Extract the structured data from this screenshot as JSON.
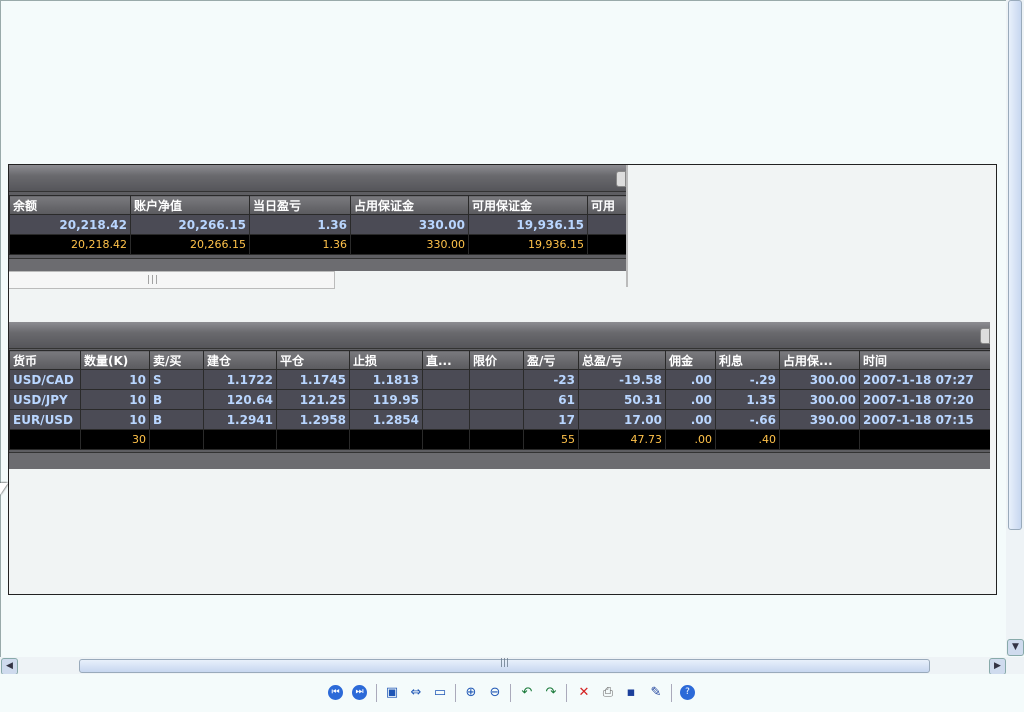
{
  "account_table": {
    "headers": [
      "余额",
      "账户净值",
      "当日盈亏",
      "占用保证金",
      "可用保证金",
      "可用"
    ],
    "row": [
      "20,218.42",
      "20,266.15",
      "1.36",
      "330.00",
      "19,936.15",
      ""
    ],
    "total": [
      "20,218.42",
      "20,266.15",
      "1.36",
      "330.00",
      "19,936.15",
      ""
    ]
  },
  "positions_table": {
    "headers": [
      "货币",
      "数量(K)",
      "卖/买",
      "建仓",
      "平仓",
      "止损",
      "直...",
      "限价",
      "盈/亏",
      "总盈/亏",
      "佣金",
      "利息",
      "占用保...",
      "时间"
    ],
    "rows": [
      [
        "USD/CAD",
        "10",
        "S",
        "1.1722",
        "1.1745",
        "1.1813",
        "",
        "",
        "-23",
        "-19.58",
        ".00",
        "-.29",
        "300.00",
        "2007-1-18 07:27"
      ],
      [
        "USD/JPY",
        "10",
        "B",
        "120.64",
        "121.25",
        "119.95",
        "",
        "",
        "61",
        "50.31",
        ".00",
        "1.35",
        "300.00",
        "2007-1-18 07:20"
      ],
      [
        "EUR/USD",
        "10",
        "B",
        "1.2941",
        "1.2958",
        "1.2854",
        "",
        "",
        "17",
        "17.00",
        ".00",
        "-.66",
        "390.00",
        "2007-1-18 07:15"
      ]
    ],
    "total": [
      "",
      "30",
      "",
      "",
      "",
      "",
      "",
      "",
      "55",
      "47.73",
      ".00",
      ".40",
      "",
      ""
    ]
  },
  "scrollbar": {
    "grip": "|||"
  },
  "toolbar": {
    "icons": [
      "first-page-icon",
      "next-page-icon",
      "fit-page-icon",
      "fit-width-icon",
      "slideshow-icon",
      "zoom-in-icon",
      "zoom-out-icon",
      "rotate-left-icon",
      "rotate-right-icon",
      "delete-icon",
      "print-icon",
      "save-icon",
      "edit-icon",
      "help-icon"
    ],
    "first": "⏮",
    "next": "⏭",
    "fit_page": "▣",
    "fit_width": "⇔",
    "slideshow": "▭",
    "zoom_in": "⊕",
    "zoom_out": "⊖",
    "rotate_left": "↶",
    "rotate_right": "↷",
    "delete": "✕",
    "print": "⎙",
    "save": "▪",
    "edit": "✎",
    "help": "?"
  }
}
